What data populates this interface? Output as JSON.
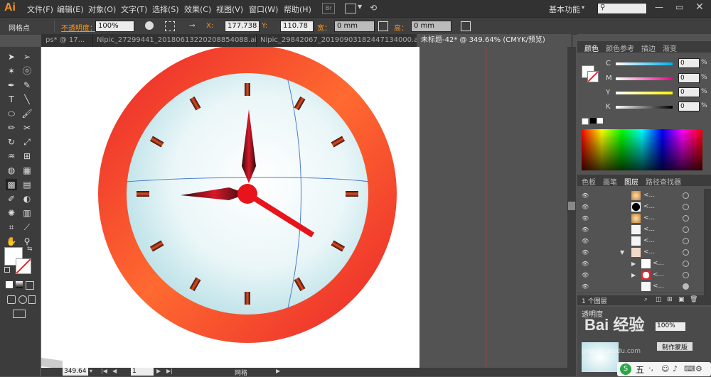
{
  "app": {
    "logo": "Ai"
  },
  "menubar": {
    "items": [
      "文件(F)",
      "编辑(E)",
      "对象(O)",
      "文字(T)",
      "选择(S)",
      "效果(C)",
      "视图(V)",
      "窗口(W)",
      "帮助(H)"
    ],
    "br_label": "Br",
    "workspace": "基本功能",
    "search_placeholder": ""
  },
  "controlbar": {
    "selection": "网格点",
    "opacity_label": "不透明度：",
    "opacity_value": "100%",
    "x_label": "X:",
    "x_value": "177.738",
    "y_label": "Y:",
    "y_value": "110.78",
    "w_label": "宽：",
    "w_value": "0 mm",
    "h_label": "高：",
    "h_value": "0 mm"
  },
  "tabs": [
    {
      "label": "ps* @ 17..."
    },
    {
      "label": "Nipic_27299441_20180613220208854088.ai*"
    },
    {
      "label": "Nipic_29842067_20190903182447134000.ai*"
    },
    {
      "label": "未标题-42* @ 349.64% (CMYK/预览)",
      "active": true
    }
  ],
  "color_panel": {
    "tabs": [
      "颜色",
      "颜色参考",
      "描边",
      "渐变"
    ],
    "channels": [
      {
        "name": "C",
        "value": "0",
        "color": "#00aeef"
      },
      {
        "name": "M",
        "value": "0",
        "color": "#ec008c"
      },
      {
        "name": "Y",
        "value": "0",
        "color": "#fff200"
      },
      {
        "name": "K",
        "value": "0",
        "color": "#000000"
      }
    ],
    "unit": "%"
  },
  "layers_panel": {
    "tabs": [
      "色板",
      "画笔",
      "图层",
      "路径查找器"
    ],
    "rows": [
      {
        "name": "<...",
        "thumb": "orb"
      },
      {
        "name": "<...",
        "thumb": "black"
      },
      {
        "name": "<...",
        "thumb": "orb"
      },
      {
        "name": "<...",
        "thumb": "blank"
      },
      {
        "name": "<...",
        "thumb": "blank"
      },
      {
        "name": "<...",
        "thumb": "group",
        "expanded": true
      },
      {
        "name": "<...",
        "thumb": "pin"
      },
      {
        "name": "<...",
        "thumb": "clock"
      },
      {
        "name": "<...",
        "thumb": "blank"
      }
    ],
    "footer": "1 个图层"
  },
  "bottom_panel": {
    "title": "透明度",
    "opacity": "100%",
    "mask_button": "制作蒙版"
  },
  "statusbar": {
    "zoom": "349.64",
    "page": "1",
    "mode": "网格"
  },
  "watermark": {
    "text": "Bai 经验",
    "sub": "jingyan.baidu.com"
  },
  "ime": {
    "label": "五"
  },
  "colors": {
    "accent_orange": "#f7941d",
    "clock_red": "#e9242b",
    "hand_red": "#e8141b"
  }
}
